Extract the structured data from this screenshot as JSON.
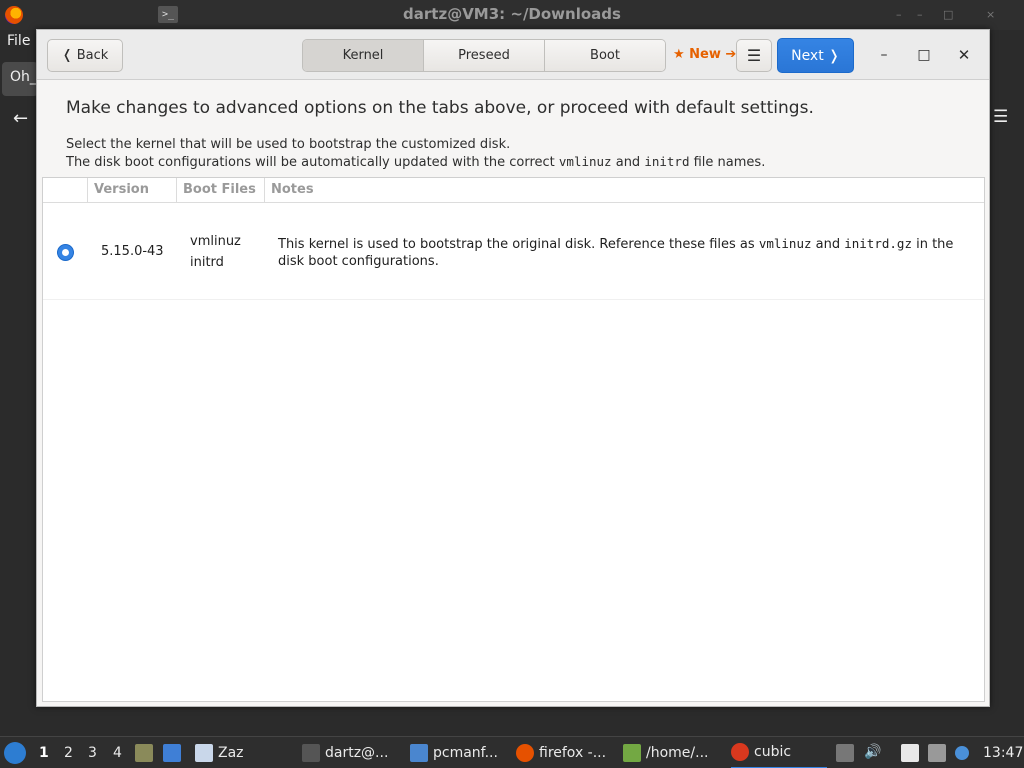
{
  "background": {
    "title": "dartz@VM3: ~/Downloads",
    "terminal_glyph": ">_",
    "file_menu": "File",
    "tab_label": "Oh_",
    "back_glyph": "←",
    "menu_glyph": "☰",
    "ctrl_glyphs": [
      "–",
      "–",
      "□",
      "×"
    ]
  },
  "header": {
    "back_label": "❬ Back",
    "tabs": [
      {
        "label": "Kernel"
      },
      {
        "label": "Preseed"
      },
      {
        "label": "Boot"
      }
    ],
    "new_label": "★ New ➔",
    "menu_glyph": "☰",
    "next_label": "Next ❭",
    "minimize_glyph": "–",
    "maximize_glyph": "□",
    "close_glyph": "✕"
  },
  "content": {
    "heading": "Make changes to advanced options on the tabs above, or proceed with default settings.",
    "desc1": "Select the kernel that will be used to bootstrap the customized disk.",
    "desc2_pre": "The disk boot configurations will be automatically updated with the correct ",
    "desc2_code1": "vmlinuz",
    "desc2_mid": " and ",
    "desc2_code2": "initrd",
    "desc2_post": " file names."
  },
  "table": {
    "columns": [
      "Version",
      "Boot Files",
      "Notes"
    ],
    "rows": [
      {
        "selected": true,
        "version": "5.15.0-43",
        "boot_file_1": "vmlinuz",
        "boot_file_2": "initrd",
        "notes_pre": "This kernel is used to bootstrap the original disk. Reference these files as ",
        "notes_code1": "vmlinuz",
        "notes_mid": " and ",
        "notes_code2": "initrd.gz",
        "notes_post": " in the disk boot configurations."
      }
    ]
  },
  "taskbar": {
    "workspaces": [
      "1",
      "2",
      "3",
      "4"
    ],
    "tasks": [
      {
        "label": "Zaz",
        "icon": "window-icon"
      },
      {
        "label": "dartz@...",
        "icon": "terminal-icon"
      },
      {
        "label": "pcmanf...",
        "icon": "folder-icon"
      },
      {
        "label": "firefox -...",
        "icon": "firefox-icon"
      },
      {
        "label": "/home/...",
        "icon": "file-icon"
      },
      {
        "label": "cubic",
        "icon": "cubic-icon"
      }
    ],
    "clock": "13:47"
  },
  "colors": {
    "accent": "#3584e4",
    "new_badge": "#e66100"
  }
}
